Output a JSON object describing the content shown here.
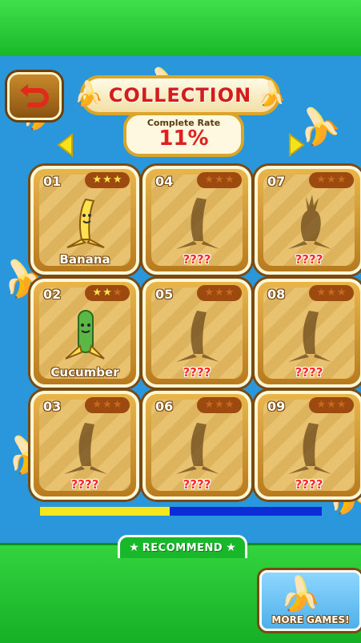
{
  "header": {
    "title": "COLLECTION"
  },
  "rate": {
    "label": "Complete Rate",
    "value": "11%"
  },
  "cards": [
    {
      "num": "01",
      "name": "Banana",
      "stars": 3,
      "unlocked": true,
      "figure": "banana-character"
    },
    {
      "num": "04",
      "name": "????",
      "stars": 0,
      "unlocked": false,
      "figure": "banana-silhouette"
    },
    {
      "num": "07",
      "name": "????",
      "stars": 0,
      "unlocked": false,
      "figure": "pineapple-silhouette"
    },
    {
      "num": "02",
      "name": "Cucumber",
      "stars": 2,
      "unlocked": true,
      "figure": "cucumber-character"
    },
    {
      "num": "05",
      "name": "????",
      "stars": 0,
      "unlocked": false,
      "figure": "banana-silhouette"
    },
    {
      "num": "08",
      "name": "????",
      "stars": 0,
      "unlocked": false,
      "figure": "banana-silhouette"
    },
    {
      "num": "03",
      "name": "????",
      "stars": 0,
      "unlocked": false,
      "figure": "banana-silhouette"
    },
    {
      "num": "06",
      "name": "????",
      "stars": 0,
      "unlocked": false,
      "figure": "banana-silhouette"
    },
    {
      "num": "09",
      "name": "????",
      "stars": 0,
      "unlocked": false,
      "figure": "banana-silhouette"
    }
  ],
  "scroll": {
    "position_fraction": 0.46
  },
  "recommend": {
    "label": "RECOMMEND"
  },
  "more_games": {
    "label": "MORE GAMES!"
  },
  "icons": {
    "back": "back-arrow-icon",
    "prev": "left-arrow-icon",
    "next": "right-arrow-icon"
  },
  "colors": {
    "accent_red": "#d31c1c",
    "gold": "#d9a52b",
    "green": "#19b82a",
    "blue_bg": "#2a97dd"
  }
}
